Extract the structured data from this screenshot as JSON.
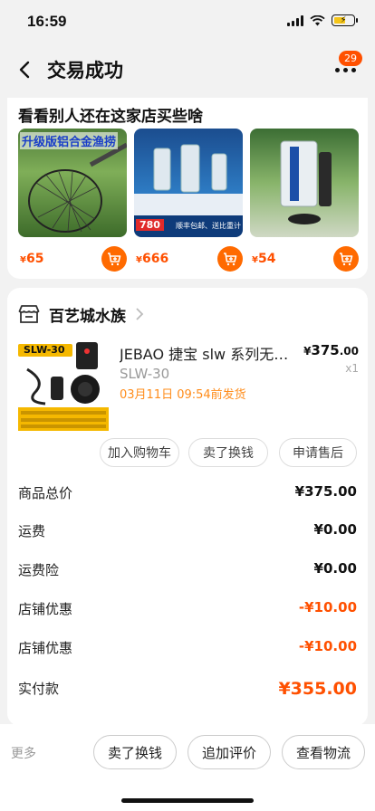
{
  "status_bar": {
    "time": "16:59"
  },
  "nav": {
    "title": "交易成功",
    "badge_count": "29"
  },
  "recommend": {
    "title": "看看别人还在这家店买些啥",
    "items": [
      {
        "price_symbol": "¥",
        "price": "65",
        "overlay_text": "升级版铝合金渔捞"
      },
      {
        "price_symbol": "¥",
        "price": "666",
        "overlay_text": "780",
        "tag_text": "顺丰包邮、送比重计"
      },
      {
        "price_symbol": "¥",
        "price": "54"
      }
    ]
  },
  "shop": {
    "name": "百艺城水族"
  },
  "product": {
    "title": "JEBAO 捷宝 slw 系列无线造浪泵",
    "sku": "SLW-30",
    "image_label": "SLW-30",
    "ship_note": "03月11日 09:54前发货",
    "price_symbol": "¥",
    "price_int": "375",
    "price_dec": ".00",
    "qty": "x1"
  },
  "actions": {
    "add_cart": "加入购物车",
    "resell": "卖了换钱",
    "after_sale": "申请售后"
  },
  "summary": [
    {
      "label": "商品总价",
      "value": "¥375.00",
      "type": "normal"
    },
    {
      "label": "运费",
      "value": "¥0.00",
      "type": "normal"
    },
    {
      "label": "运费险",
      "value": "¥0.00",
      "type": "normal"
    },
    {
      "label": "店铺优惠",
      "value": "-¥10.00",
      "type": "disc"
    },
    {
      "label": "店铺优惠",
      "value": "-¥10.00",
      "type": "disc"
    },
    {
      "label": "实付款",
      "value": "¥355.00",
      "type": "total"
    }
  ],
  "bottom": {
    "more": "更多",
    "resell": "卖了换钱",
    "review": "追加评价",
    "logistics": "查看物流"
  },
  "colors": {
    "accent": "#ff5000",
    "orange_button": "#ff6a00",
    "ship_note": "#ff8c1a"
  }
}
